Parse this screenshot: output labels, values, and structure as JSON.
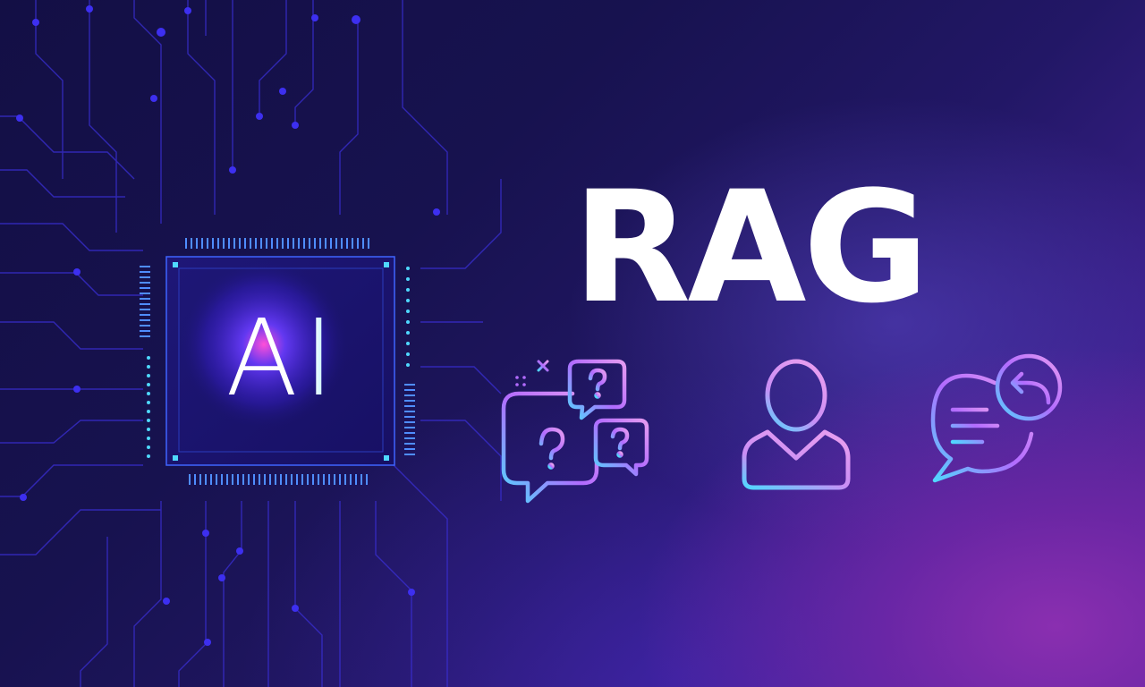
{
  "chip": {
    "label": "AI"
  },
  "headline": {
    "text": "RAG"
  },
  "flow": {
    "steps": [
      {
        "icon": "question-bubbles-icon"
      },
      {
        "icon": "user-icon"
      },
      {
        "icon": "reply-message-icon"
      }
    ]
  },
  "colors": {
    "background_dark": "#14104a",
    "background_glow": "#8a2fb0",
    "accent_cyan": "#4fd8ff",
    "accent_violet": "#b26bff",
    "accent_pink": "#e59cf0",
    "text": "#ffffff"
  }
}
